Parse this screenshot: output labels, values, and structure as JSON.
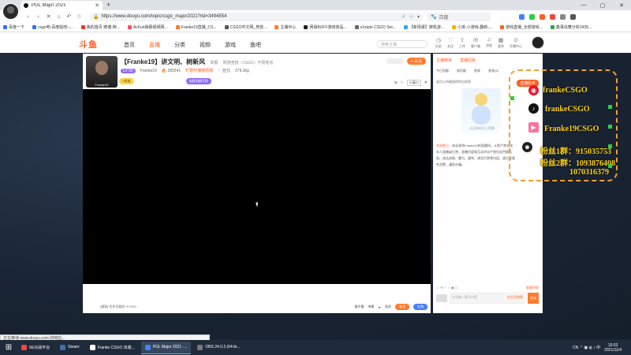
{
  "browser": {
    "tab_title": "PGL Major 2021",
    "url": "https://www.douyu.com/topic/csgo_major2021?rid=3494554",
    "search_engine": "百度",
    "controls": {
      "minimize": "—",
      "maximize": "▢",
      "close": "✕"
    }
  },
  "bookmarks": [
    {
      "label": "百度一下",
      "color": "#3a6cf4"
    },
    {
      "label": "csgo吧-百度贴吧--...",
      "color": "#3a6cf4"
    },
    {
      "label": "我的首页 微博-随...",
      "color": "#e6352b"
    },
    {
      "label": "AcFun弹幕视频网...",
      "color": "#fd4c5d"
    },
    {
      "label": "Franke19直播_CS...",
      "color": "#ff7a2f"
    },
    {
      "label": "CSGO中文网_竞技...",
      "color": "#555555"
    },
    {
      "label": "主播中心",
      "color": "#ff7a2f"
    },
    {
      "label": "网易BUFF游戏饰品...",
      "color": "#222222"
    },
    {
      "label": "s1mple CSGO Set...",
      "color": "#666666"
    },
    {
      "label": "【新情报】牌机游...",
      "color": "#3aa0f4"
    },
    {
      "label": "小孩-小游戏-翻新,...",
      "color": "#f4b400"
    },
    {
      "label": "游戏直播_全部游戏...",
      "color": "#ff5d23"
    },
    {
      "label": "鑫事炫舞分析2435...",
      "color": "#2e9e4f"
    }
  ],
  "site": {
    "logo": "斗鱼",
    "nav": [
      "首页",
      "直播",
      "分类",
      "视频",
      "游戏",
      "鱼吧"
    ],
    "active_nav": "直播",
    "search_placeholder": "搜索主播",
    "user_icons": [
      {
        "icon": "history-icon",
        "glyph": "◷",
        "label": "历史"
      },
      {
        "icon": "follow-icon",
        "glyph": "♡",
        "label": "关注"
      },
      {
        "icon": "upload-icon",
        "glyph": "⇧",
        "label": "上传"
      },
      {
        "icon": "message-icon",
        "glyph": "✉",
        "label": "客户端"
      },
      {
        "icon": "bell-icon",
        "glyph": "♫",
        "label": "消息"
      },
      {
        "icon": "grid-icon",
        "glyph": "▦",
        "label": "更多"
      },
      {
        "icon": "location-icon",
        "glyph": "⊙",
        "label": "开播中心"
      }
    ]
  },
  "room": {
    "title": "【Franke19】讲文明、树新风",
    "report": "举报",
    "category": "网游竞技 › CSGO › 不限地点",
    "level": "LV 50",
    "anchor": "Franke19",
    "hot": "🔥 289541",
    "rank": "旷野开播榜周榜",
    "fans_label": "♡ 亚元",
    "fans_count": "279.2kg",
    "vip": "V贵族",
    "group": "加群加圈子群",
    "follow": "+ 关注",
    "tools": [
      "⇲",
      "☆",
      "小窗口",
      "✕"
    ]
  },
  "chatbar": {
    "notice": "[通知] 任何可能的~KYS01",
    "tools": [
      "循环播",
      "弹幕",
      "★",
      "画质"
    ],
    "btn_send": "发送",
    "btn_gift": "礼物"
  },
  "rightpanel": {
    "tabs": [
      "主播榜单",
      "直播回看"
    ],
    "subtabs": [
      "今日贡献",
      "周贡献",
      "贵宾",
      "贵宾(3)"
    ],
    "empty_text": "虚位以待最值得的拉前榜",
    "caption": "还没有粉丝上榜哦",
    "sys_label": "系统提示:",
    "sys_msg": "欢迎来到Franke19的直播间。斗鱼严禁未成年人直播或打赏，直播内容和互动评论严禁包含色情低俗、违法违规、暴力、谩骂、诱导打赏等内容。请大家理性消费，谨防诈骗。",
    "bottom_left": "☺ ✉ ♡ ☆ ▣ ▢",
    "bottom_right": "屏蔽特效",
    "input_placeholder": "这里输入聊天内容",
    "input_hint": "粉丝团弹幕",
    "send": "发送"
  },
  "overlay": {
    "rec_label": "直播助手",
    "weibo": "frankeCSGO",
    "douyin": "frankeCSGO",
    "bilibili": "Franke19CSGO",
    "qq1": "粉丝1群：915035753",
    "qq2": "粉丝2群：1093876408",
    "qq3": "1070316379"
  },
  "statusbar": "正在等待 www.douyu.com 的响应...",
  "taskbar": {
    "items": [
      {
        "label": "5E对战平台",
        "color": "#e94b3c"
      },
      {
        "label": "Steam",
        "color": "#3d6fa8"
      },
      {
        "label": "Franke CSGO 出装...",
        "color": "#ffffff"
      },
      {
        "label": "PGL Major 2021 -...",
        "color": "#4285f4"
      },
      {
        "label": "OBS 24.0.3 (64-bi...",
        "color": "#777777"
      }
    ],
    "tray": "CN ⌃ ▣ ◍ ♪ 中",
    "time": "15:03",
    "date": "2021/11/4"
  }
}
